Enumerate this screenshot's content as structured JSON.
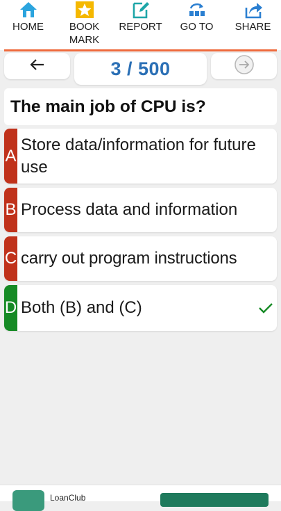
{
  "toolbar": {
    "items": [
      {
        "label": "HOME",
        "icon": "home-icon"
      },
      {
        "label": "BOOK\nMARK",
        "icon": "star-bookmark-icon"
      },
      {
        "label": "REPORT",
        "icon": "edit-report-icon"
      },
      {
        "label": "GO TO",
        "icon": "goto-icon"
      },
      {
        "label": "SHARE",
        "icon": "share-icon"
      }
    ],
    "accent_color": "#ef6a3c"
  },
  "navigation": {
    "counter": "3 / 500",
    "prev_icon": "arrow-left-icon",
    "next_icon": "arrow-right-circle-icon"
  },
  "question": {
    "text": "The main job of CPU is?"
  },
  "options": [
    {
      "letter": "A",
      "text": "Store data/information for future use",
      "color": "#c0321b",
      "correct": false
    },
    {
      "letter": "B",
      "text": "Process data and information",
      "color": "#c0321b",
      "correct": false
    },
    {
      "letter": "C",
      "text": "carry out program instructions",
      "color": "#c0321b",
      "correct": false
    },
    {
      "letter": "D",
      "text": "Both (B) and (C)",
      "color": "#168a25",
      "correct": true
    }
  ],
  "ad": {
    "name": "LoanClub"
  }
}
